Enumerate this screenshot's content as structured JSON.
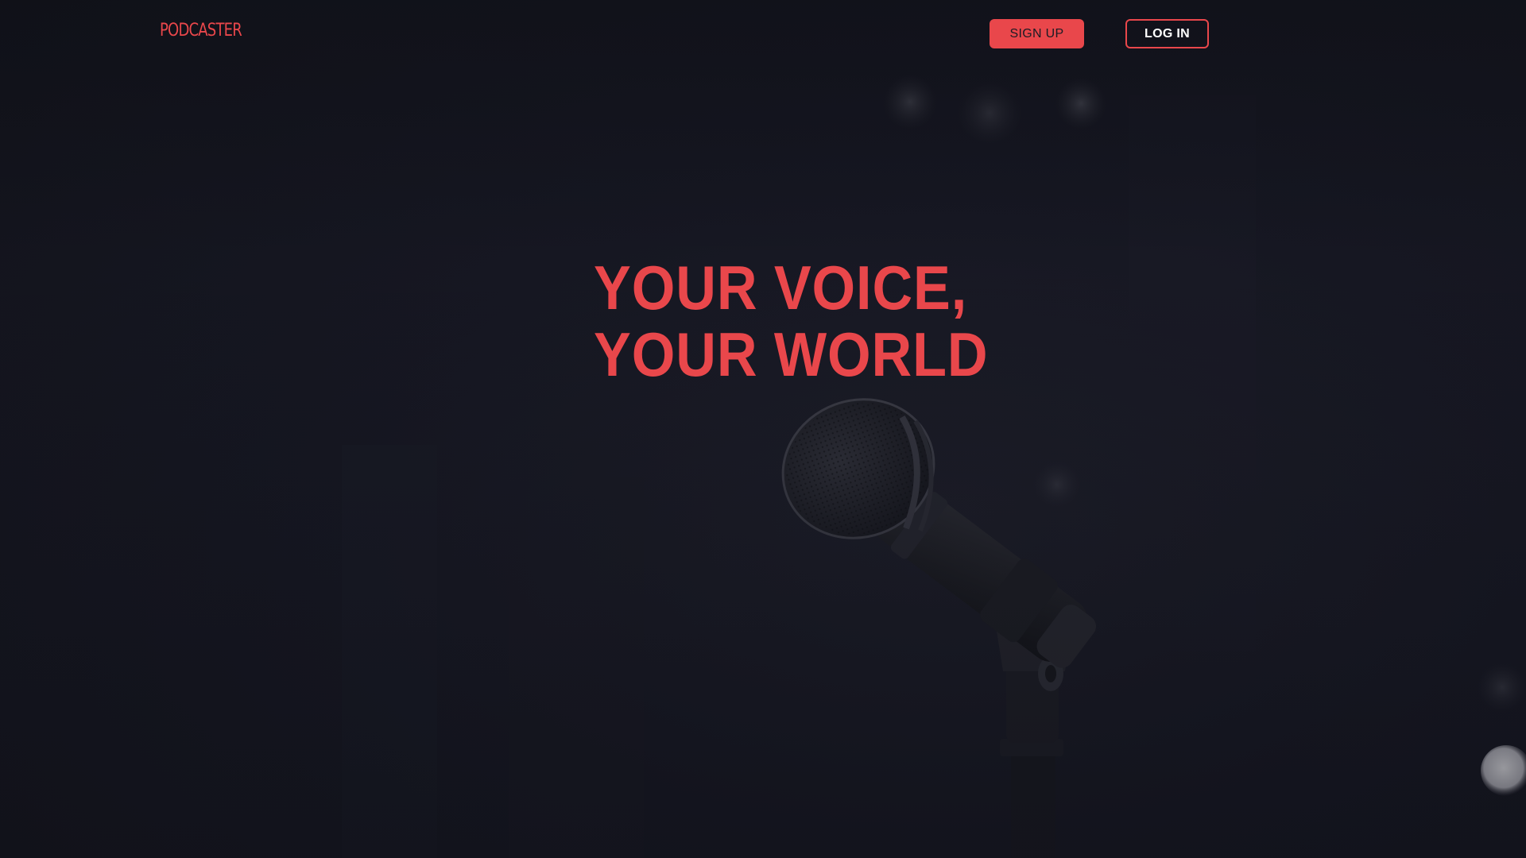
{
  "brand": {
    "name": "PODCASTER"
  },
  "nav": {
    "signup_label": "SIGN UP",
    "login_label": "LOG IN"
  },
  "hero": {
    "line1": "YOUR VOICE,",
    "line2": "YOUR WORLD"
  },
  "background": {
    "image": "microphone-on-stand-photo"
  },
  "colors": {
    "background": "#151620",
    "accent": "#e9474b",
    "button_text_dark": "#1a1b24",
    "button_text_light": "#ffffff"
  }
}
